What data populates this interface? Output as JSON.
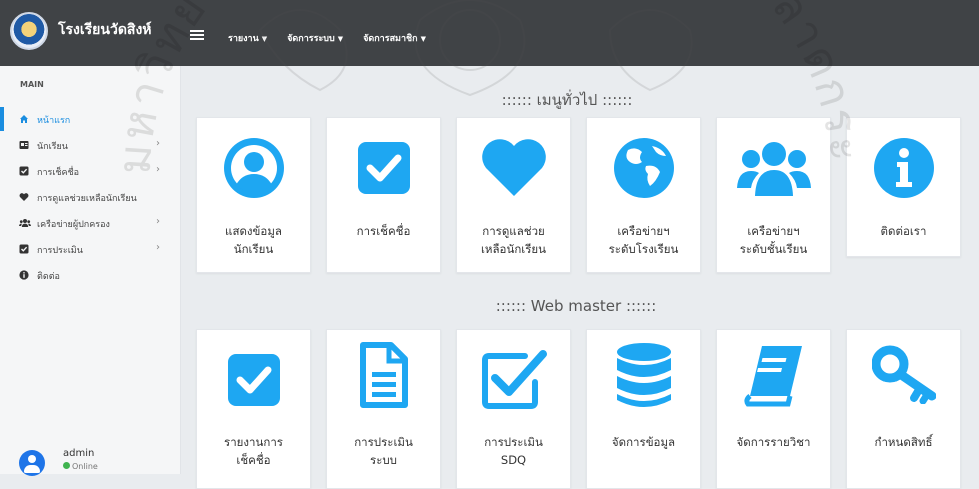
{
  "navbar": {
    "brand": "โรงเรียนวัดสิงห์",
    "menus": [
      {
        "label": "รายงาน"
      },
      {
        "label": "จัดการระบบ"
      },
      {
        "label": "จัดการสมาชิก"
      }
    ]
  },
  "sidebar": {
    "heading": "MAIN",
    "items": [
      {
        "label": "หน้าแรก",
        "icon": "home-icon",
        "active": true
      },
      {
        "label": "นักเรียน",
        "icon": "id-card-icon",
        "chevron": true
      },
      {
        "label": "การเช็คชื่อ",
        "icon": "check-square-icon",
        "chevron": true
      },
      {
        "label": "การดูแลช่วยเหลือนักเรียน",
        "icon": "heart-icon"
      },
      {
        "label": "เครือข่ายผู้ปกครอง",
        "icon": "users-icon",
        "chevron": true
      },
      {
        "label": "การประเมิน",
        "icon": "check-square-icon",
        "chevron": true
      },
      {
        "label": "ติดต่อ",
        "icon": "info-circle-icon"
      }
    ]
  },
  "user": {
    "name": "admin",
    "status": "Online"
  },
  "general_menu": {
    "title": ":::::: เมนูทั่วไป ::::::",
    "cards": [
      {
        "label": "แสดงข้อมูล\nนักเรียน",
        "icon": "user-circle-icon"
      },
      {
        "label": "การเช็คชื่อ",
        "icon": "check-square-icon"
      },
      {
        "label": "การดูแลช่วย\nเหลือนักเรียน",
        "icon": "heart-icon"
      },
      {
        "label": "เครือข่ายฯ\nระดับโรงเรียน",
        "icon": "globe-icon"
      },
      {
        "label": "เครือข่ายฯ\nระดับชั้นเรียน",
        "icon": "users-icon"
      },
      {
        "label": "ติดต่อเรา",
        "icon": "info-circle-icon"
      }
    ]
  },
  "webmaster_menu": {
    "title": ":::::: Web master ::::::",
    "cards": [
      {
        "label": "รายงานการ\nเช็คชื่อ",
        "icon": "check-square-icon"
      },
      {
        "label": "การประเมิน\nระบบ",
        "icon": "file-text-icon"
      },
      {
        "label": "การประเมิน\nSDQ",
        "icon": "check-box-outline-icon"
      },
      {
        "label": "จัดการข้อมูล",
        "icon": "database-icon"
      },
      {
        "label": "จัดการรายวิชา",
        "icon": "book-icon"
      },
      {
        "label": "กำหนดสิทธิ์",
        "icon": "key-icon"
      }
    ]
  },
  "watermark": "มหาวิทยาลัยพระจอมเกล้าเจ้าคุณทหารลาดกระบัง",
  "colors": {
    "accent": "#1ea7f2",
    "navbar": "#404346",
    "sidebar_active": "#1a8de0"
  }
}
